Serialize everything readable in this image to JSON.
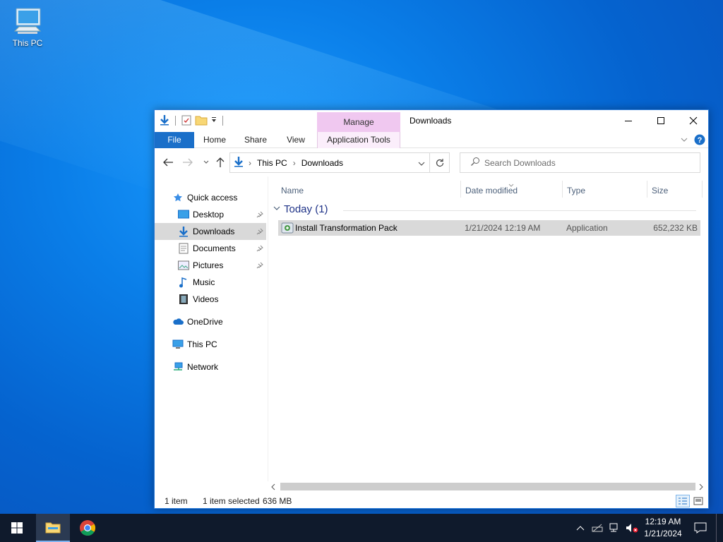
{
  "desktop": {
    "icons": [
      {
        "label": "This PC",
        "icon": "computer-icon"
      }
    ]
  },
  "window": {
    "title": "Downloads",
    "contextual_tab_group": "Manage",
    "ribbon_tabs": [
      "File",
      "Home",
      "Share",
      "View",
      "Application Tools"
    ],
    "address": {
      "crumbs": [
        "This PC",
        "Downloads"
      ]
    },
    "search": {
      "placeholder": "Search Downloads"
    },
    "nav": {
      "quick_access": "Quick access",
      "items": [
        {
          "label": "Desktop",
          "icon": "desktop-folder-icon",
          "pinned": true
        },
        {
          "label": "Downloads",
          "icon": "downloads-folder-icon",
          "pinned": true,
          "selected": true
        },
        {
          "label": "Documents",
          "icon": "documents-folder-icon",
          "pinned": true
        },
        {
          "label": "Pictures",
          "icon": "pictures-folder-icon",
          "pinned": true
        },
        {
          "label": "Music",
          "icon": "music-folder-icon",
          "pinned": false
        },
        {
          "label": "Videos",
          "icon": "videos-folder-icon",
          "pinned": false
        }
      ],
      "onedrive": "OneDrive",
      "this_pc": "This PC",
      "network": "Network"
    },
    "columns": [
      "Name",
      "Date modified",
      "Type",
      "Size"
    ],
    "group": {
      "label": "Today (1)"
    },
    "files": [
      {
        "name": "Install Transformation Pack",
        "date_modified": "1/21/2024 12:19 AM",
        "type": "Application",
        "size": "652,232 KB",
        "selected": true
      }
    ],
    "status": {
      "count": "1 item",
      "selection": "1 item selected",
      "size": "636 MB"
    }
  },
  "taskbar": {
    "clock": {
      "time": "12:19 AM",
      "date": "1/21/2024"
    },
    "apps": [
      "file-explorer-icon",
      "chrome-icon"
    ]
  },
  "colors": {
    "accent": "#1a6fc9",
    "manage_tab": "#f0c8f0",
    "group_text": "#1e3287",
    "taskbar": "#0f1a2c"
  }
}
